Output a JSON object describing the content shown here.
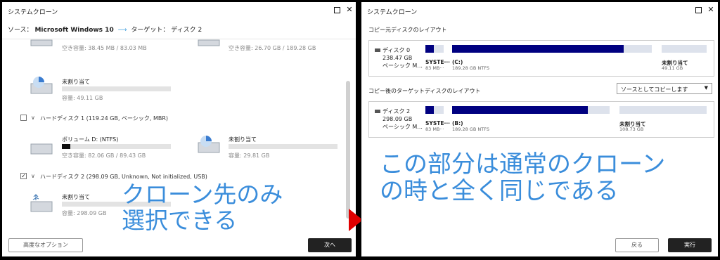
{
  "left_window": {
    "title": "システムクローン",
    "source_prefix": "ソース：",
    "source_name": "Microsoft Windows 10",
    "target_prefix": "ターゲット：",
    "target_name": "ディスク 2",
    "top_partial": [
      {
        "capacity": "空き容量: 38.45 MB / 83.03 MB"
      },
      {
        "capacity": "空き容量: 26.70 GB / 189.28 GB"
      }
    ],
    "disk0_unalloc": {
      "name": "未割り当て",
      "capacity": "容量: 49.11 GB"
    },
    "hard_disk_1": {
      "label": "ハードディスク 1 (119.24 GB, ベーシック, MBR)",
      "checked": false
    },
    "disk1_partitions": [
      {
        "name": "ボリューム D: (NTFS)",
        "capacity": "空き容量: 82.06 GB / 89.43 GB",
        "used_fraction": 0.08
      },
      {
        "name": "未割り当て",
        "capacity": "容量: 29.81 GB"
      }
    ],
    "hard_disk_2": {
      "label": "ハードディスク 2 (298.09 GB, Unknown, Not initialized, USB)",
      "checked": true,
      "check_mark": "✓"
    },
    "disk2_unalloc": {
      "name": "未割り当て",
      "capacity": "容量: 298.09 GB"
    },
    "overlay_text_line1": "クローン先のみ",
    "overlay_text_line2": "選択できる",
    "advanced_options_button": "高度なオプション",
    "next_button": "次へ"
  },
  "right_window": {
    "title": "システムクローン",
    "copy_source_layout_title": "コピー元ディスクのレイアウト",
    "after_copy_layout_title": "コピー後のターゲットディスクのレイアウト",
    "copy_mode_select": "ソースとしてコピーします",
    "source_disk": {
      "name": "ディスク 0",
      "size": "238.47 GB",
      "type": "ベーシック M...",
      "partitions": [
        {
          "name": "SYSTE···",
          "info": "83 MB···",
          "used_fraction": 0.45
        },
        {
          "name": "(C:)",
          "info": "189.28 GB NTFS",
          "used_fraction": 0.86
        },
        {
          "name": "未割り当て",
          "info": "49.11 GB",
          "used_fraction": 0
        }
      ]
    },
    "target_disk": {
      "name": "ディスク 2",
      "size": "298.09 GB",
      "type": "ベーシック M...",
      "partitions": [
        {
          "name": "SYSTE···",
          "info": "83 MB···",
          "used_fraction": 0.45
        },
        {
          "name": "(B:)",
          "info": "189.28 GB NTFS",
          "used_fraction": 0.86
        },
        {
          "name": "未割り当て",
          "info": "108.73 GB",
          "used_fraction": 0
        }
      ]
    },
    "overlay_text_line1": "この部分は通常のクローン",
    "overlay_text_line2": "の時と全く同じである",
    "back_button": "戻る",
    "execute_button": "実行"
  },
  "icons": {
    "minimize": "minimize-icon",
    "maximize": "maximize-icon",
    "close": "close-icon",
    "arrow": "right-arrow-icon"
  },
  "colors": {
    "accent_blue": "#3a8ddb",
    "partition_fill": "#000080",
    "pointer_red": "#e00000"
  }
}
